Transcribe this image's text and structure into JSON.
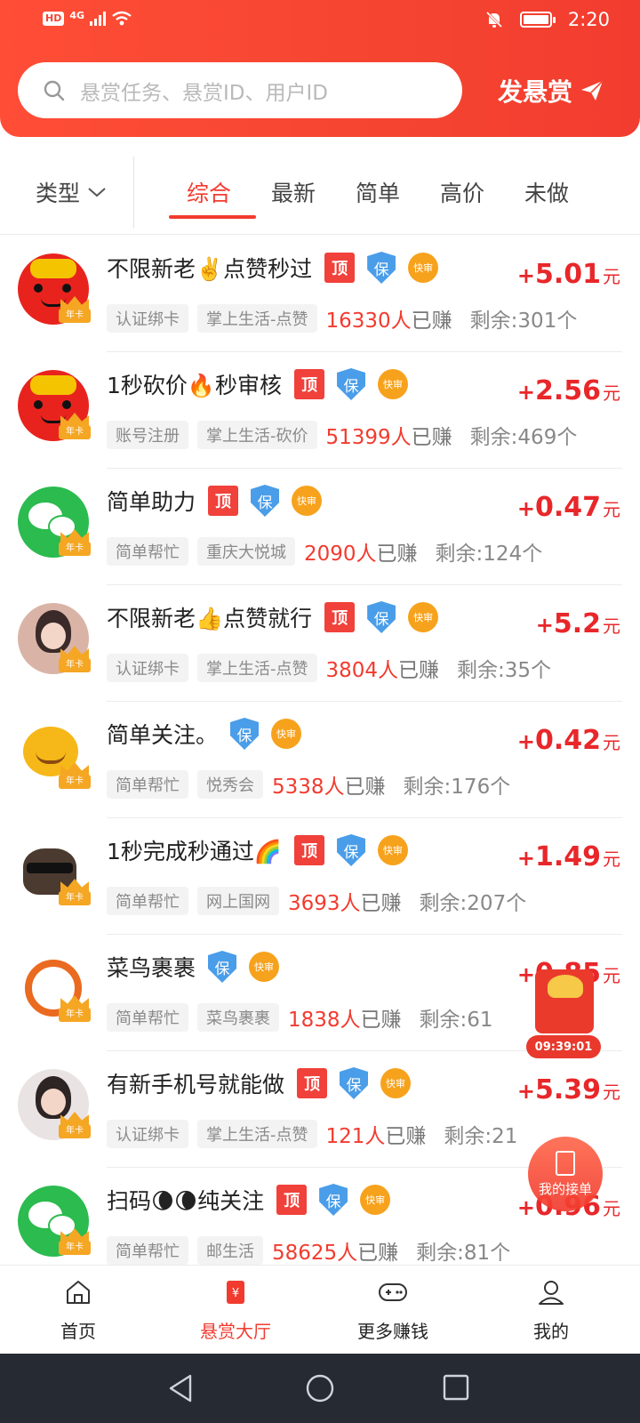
{
  "status_bar": {
    "hd": "HD",
    "network": "4G",
    "time": "2:20"
  },
  "header": {
    "search_placeholder": "悬赏任务、悬赏ID、用户ID",
    "publish_label": "发悬赏"
  },
  "filter": {
    "type_label": "类型",
    "tabs": [
      "综合",
      "最新",
      "简单",
      "高价",
      "未做"
    ],
    "active_tab": "综合"
  },
  "badges": {
    "top": "顶",
    "bao": "保",
    "fast": "快审",
    "annual": "年卡"
  },
  "tasks": [
    {
      "title": "不限新老✌️点赞秒过",
      "tags": [
        "认证绑卡",
        "掌上生活-点赞"
      ],
      "earned_count": "16330人",
      "earned_suffix": "已赚",
      "remain": "剩余:301个",
      "reward_plus": "+",
      "reward": "5.01",
      "unit": "元"
    },
    {
      "title": "1秒砍价🔥秒审核",
      "tags": [
        "账号注册",
        "掌上生活-砍价"
      ],
      "earned_count": "51399人",
      "earned_suffix": "已赚",
      "remain": "剩余:469个",
      "reward_plus": "+",
      "reward": "2.56",
      "unit": "元"
    },
    {
      "title": "简单助力",
      "tags": [
        "简单帮忙",
        "重庆大悦城"
      ],
      "earned_count": "2090人",
      "earned_suffix": "已赚",
      "remain": "剩余:124个",
      "reward_plus": "+",
      "reward": "0.47",
      "unit": "元"
    },
    {
      "title": "不限新老👍点赞就行",
      "tags": [
        "认证绑卡",
        "掌上生活-点赞"
      ],
      "earned_count": "3804人",
      "earned_suffix": "已赚",
      "remain": "剩余:35个",
      "reward_plus": "+",
      "reward": "5.2",
      "unit": "元"
    },
    {
      "title": "简单关注。",
      "tags": [
        "简单帮忙",
        "悦秀会"
      ],
      "earned_count": "5338人",
      "earned_suffix": "已赚",
      "remain": "剩余:176个",
      "reward_plus": "+",
      "reward": "0.42",
      "unit": "元"
    },
    {
      "title": "1秒完成秒通过🌈",
      "tags": [
        "简单帮忙",
        "网上国网"
      ],
      "earned_count": "3693人",
      "earned_suffix": "已赚",
      "remain": "剩余:207个",
      "reward_plus": "+",
      "reward": "1.49",
      "unit": "元"
    },
    {
      "title": "菜鸟裹裹",
      "tags": [
        "简单帮忙",
        "菜鸟裹裹"
      ],
      "earned_count": "1838人",
      "earned_suffix": "已赚",
      "remain": "剩余:61",
      "reward_plus": "+",
      "reward": "0.85",
      "unit": "元"
    },
    {
      "title": "有新手机号就能做",
      "tags": [
        "认证绑卡",
        "掌上生活-点赞"
      ],
      "earned_count": "121人",
      "earned_suffix": "已赚",
      "remain": "剩余:21",
      "reward_plus": "+",
      "reward": "5.39",
      "unit": "元"
    },
    {
      "title": "扫码🌘🌘纯关注",
      "tags": [
        "简单帮忙",
        "邮生活"
      ],
      "earned_count": "58625人",
      "earned_suffix": "已赚",
      "remain": "剩余:81个",
      "reward_plus": "+",
      "reward": "0.96",
      "unit": "元"
    }
  ],
  "floating": {
    "redpack_timer": "09:39:01",
    "my_orders": "我的接单"
  },
  "bottom_nav": [
    {
      "label": "首页",
      "icon": "home-icon"
    },
    {
      "label": "悬赏大厅",
      "icon": "reward-hall-icon"
    },
    {
      "label": "更多赚钱",
      "icon": "gamepad-icon"
    },
    {
      "label": "我的",
      "icon": "profile-icon"
    }
  ],
  "colors": {
    "accent": "#f23b2f",
    "header": "#f5452f",
    "reward": "#e8272a"
  }
}
